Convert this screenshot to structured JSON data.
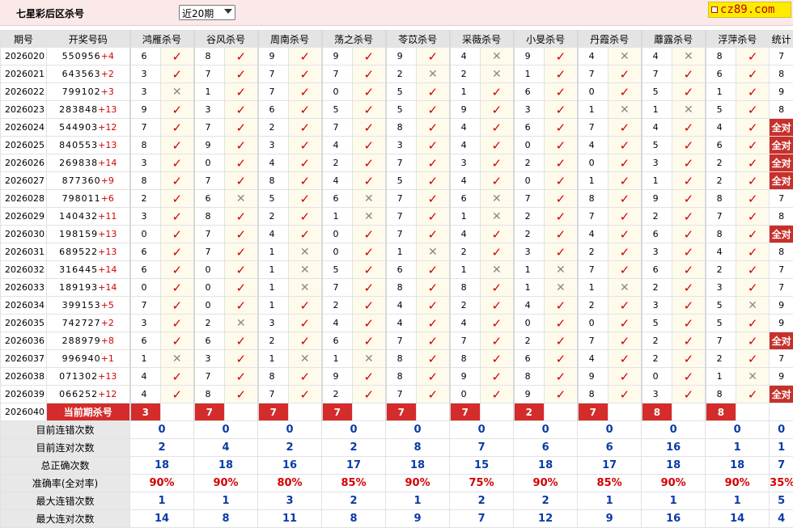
{
  "header": {
    "title": "七星彩后区杀号",
    "period_select": "近20期",
    "logo": "cz89.com"
  },
  "columns": [
    "期号",
    "开奖号码",
    "鸿雁杀号",
    "谷风杀号",
    "周南杀号",
    "荡之杀号",
    "苓苡杀号",
    "采薇杀号",
    "小旻杀号",
    "丹霞杀号",
    "蘼露杀号",
    "浮萍杀号",
    "统计"
  ],
  "rows": [
    {
      "p": "2026020",
      "n": "550956",
      "b": "+4",
      "k": [
        "6",
        "8",
        "9",
        "9",
        "9",
        "4",
        "9",
        "4",
        "4",
        "8"
      ],
      "r": [
        1,
        1,
        1,
        1,
        1,
        0,
        1,
        0,
        0,
        1
      ],
      "s": "7"
    },
    {
      "p": "2026021",
      "n": "643563",
      "b": "+2",
      "k": [
        "3",
        "7",
        "7",
        "7",
        "2",
        "2",
        "1",
        "7",
        "7",
        "6"
      ],
      "r": [
        1,
        1,
        1,
        1,
        0,
        0,
        1,
        1,
        1,
        1
      ],
      "s": "8"
    },
    {
      "p": "2026022",
      "n": "799102",
      "b": "+3",
      "k": [
        "3",
        "1",
        "7",
        "0",
        "5",
        "1",
        "6",
        "0",
        "5",
        "1"
      ],
      "r": [
        0,
        1,
        1,
        1,
        1,
        1,
        1,
        1,
        1,
        1
      ],
      "s": "9"
    },
    {
      "p": "2026023",
      "n": "283848",
      "b": "+13",
      "k": [
        "9",
        "3",
        "6",
        "5",
        "5",
        "9",
        "3",
        "1",
        "1",
        "5"
      ],
      "r": [
        1,
        1,
        1,
        1,
        1,
        1,
        1,
        0,
        0,
        1
      ],
      "s": "8"
    },
    {
      "p": "2026024",
      "n": "544903",
      "b": "+12",
      "k": [
        "7",
        "7",
        "2",
        "7",
        "8",
        "4",
        "6",
        "7",
        "4",
        "4"
      ],
      "r": [
        1,
        1,
        1,
        1,
        1,
        1,
        1,
        1,
        1,
        1
      ],
      "s": "全对"
    },
    {
      "p": "2026025",
      "n": "840553",
      "b": "+13",
      "k": [
        "8",
        "9",
        "3",
        "4",
        "3",
        "4",
        "0",
        "4",
        "5",
        "6"
      ],
      "r": [
        1,
        1,
        1,
        1,
        1,
        1,
        1,
        1,
        1,
        1
      ],
      "s": "全对"
    },
    {
      "p": "2026026",
      "n": "269838",
      "b": "+14",
      "k": [
        "3",
        "0",
        "4",
        "2",
        "7",
        "3",
        "2",
        "0",
        "3",
        "2"
      ],
      "r": [
        1,
        1,
        1,
        1,
        1,
        1,
        1,
        1,
        1,
        1
      ],
      "s": "全对"
    },
    {
      "p": "2026027",
      "n": "877360",
      "b": "+9",
      "k": [
        "8",
        "7",
        "8",
        "4",
        "5",
        "4",
        "0",
        "1",
        "1",
        "2"
      ],
      "r": [
        1,
        1,
        1,
        1,
        1,
        1,
        1,
        1,
        1,
        1
      ],
      "s": "全对"
    },
    {
      "p": "2026028",
      "n": "798011",
      "b": "+6",
      "k": [
        "2",
        "6",
        "5",
        "6",
        "7",
        "6",
        "7",
        "8",
        "9",
        "8"
      ],
      "r": [
        1,
        0,
        1,
        0,
        1,
        0,
        1,
        1,
        1,
        1
      ],
      "s": "7"
    },
    {
      "p": "2026029",
      "n": "140432",
      "b": "+11",
      "k": [
        "3",
        "8",
        "2",
        "1",
        "7",
        "1",
        "2",
        "7",
        "2",
        "7"
      ],
      "r": [
        1,
        1,
        1,
        0,
        1,
        0,
        1,
        1,
        1,
        1
      ],
      "s": "8"
    },
    {
      "p": "2026030",
      "n": "198159",
      "b": "+13",
      "k": [
        "0",
        "7",
        "4",
        "0",
        "7",
        "4",
        "2",
        "4",
        "6",
        "8"
      ],
      "r": [
        1,
        1,
        1,
        1,
        1,
        1,
        1,
        1,
        1,
        1
      ],
      "s": "全对"
    },
    {
      "p": "2026031",
      "n": "689522",
      "b": "+13",
      "k": [
        "6",
        "7",
        "1",
        "0",
        "1",
        "2",
        "3",
        "2",
        "3",
        "4"
      ],
      "r": [
        1,
        1,
        0,
        1,
        0,
        1,
        1,
        1,
        1,
        1
      ],
      "s": "8"
    },
    {
      "p": "2026032",
      "n": "316445",
      "b": "+14",
      "k": [
        "6",
        "0",
        "1",
        "5",
        "6",
        "1",
        "1",
        "7",
        "6",
        "2"
      ],
      "r": [
        1,
        1,
        0,
        1,
        1,
        0,
        0,
        1,
        1,
        1
      ],
      "s": "7"
    },
    {
      "p": "2026033",
      "n": "189193",
      "b": "+14",
      "k": [
        "0",
        "0",
        "1",
        "7",
        "8",
        "8",
        "1",
        "1",
        "2",
        "3"
      ],
      "r": [
        1,
        1,
        0,
        1,
        1,
        1,
        0,
        0,
        1,
        1
      ],
      "s": "7"
    },
    {
      "p": "2026034",
      "n": "399153",
      "b": "+5",
      "k": [
        "7",
        "0",
        "1",
        "2",
        "4",
        "2",
        "4",
        "2",
        "3",
        "5"
      ],
      "r": [
        1,
        1,
        1,
        1,
        1,
        1,
        1,
        1,
        1,
        0
      ],
      "s": "9"
    },
    {
      "p": "2026035",
      "n": "742727",
      "b": "+2",
      "k": [
        "3",
        "2",
        "3",
        "4",
        "4",
        "4",
        "0",
        "0",
        "5",
        "5"
      ],
      "r": [
        1,
        0,
        1,
        1,
        1,
        1,
        1,
        1,
        1,
        1
      ],
      "s": "9"
    },
    {
      "p": "2026036",
      "n": "288979",
      "b": "+8",
      "k": [
        "6",
        "6",
        "2",
        "6",
        "7",
        "7",
        "2",
        "7",
        "2",
        "7"
      ],
      "r": [
        1,
        1,
        1,
        1,
        1,
        1,
        1,
        1,
        1,
        1
      ],
      "s": "全对"
    },
    {
      "p": "2026037",
      "n": "996940",
      "b": "+1",
      "k": [
        "1",
        "3",
        "1",
        "1",
        "8",
        "8",
        "6",
        "4",
        "2",
        "2"
      ],
      "r": [
        0,
        1,
        0,
        0,
        1,
        1,
        1,
        1,
        1,
        1
      ],
      "s": "7"
    },
    {
      "p": "2026038",
      "n": "071302",
      "b": "+13",
      "k": [
        "4",
        "7",
        "8",
        "9",
        "8",
        "9",
        "8",
        "9",
        "0",
        "1"
      ],
      "r": [
        1,
        1,
        1,
        1,
        1,
        1,
        1,
        1,
        1,
        0
      ],
      "s": "9"
    },
    {
      "p": "2026039",
      "n": "066252",
      "b": "+12",
      "k": [
        "4",
        "8",
        "7",
        "2",
        "7",
        "0",
        "9",
        "8",
        "3",
        "8"
      ],
      "r": [
        1,
        1,
        1,
        1,
        1,
        1,
        1,
        1,
        1,
        1
      ],
      "s": "全对"
    }
  ],
  "current": {
    "p": "2026040",
    "label": "当前期杀号",
    "k": [
      "3",
      "7",
      "7",
      "7",
      "7",
      "7",
      "2",
      "7",
      "8",
      "8"
    ]
  },
  "stats": [
    {
      "label": "目前连错次数",
      "v": [
        "0",
        "0",
        "0",
        "0",
        "0",
        "0",
        "0",
        "0",
        "0",
        "0",
        "0"
      ]
    },
    {
      "label": "目前连对次数",
      "v": [
        "2",
        "4",
        "2",
        "2",
        "8",
        "7",
        "6",
        "6",
        "16",
        "1",
        "1"
      ]
    },
    {
      "label": "总正确次数",
      "v": [
        "18",
        "18",
        "16",
        "17",
        "18",
        "15",
        "18",
        "17",
        "18",
        "18",
        "7"
      ]
    },
    {
      "label": "准确率(全对率)",
      "v": [
        "90%",
        "90%",
        "80%",
        "85%",
        "90%",
        "75%",
        "90%",
        "85%",
        "90%",
        "90%",
        "35%"
      ],
      "red": true
    },
    {
      "label": "最大连错次数",
      "v": [
        "1",
        "1",
        "3",
        "2",
        "1",
        "2",
        "2",
        "1",
        "1",
        "1",
        "5"
      ]
    },
    {
      "label": "最大连对次数",
      "v": [
        "14",
        "8",
        "11",
        "8",
        "9",
        "7",
        "12",
        "9",
        "16",
        "14",
        "4"
      ]
    }
  ],
  "marks": {
    "right": "✓",
    "wrong": "✕"
  },
  "colors": {
    "accent_red": "#d42b2b",
    "mark_right": "#d20000",
    "stat_blue": "#0b3aa8"
  }
}
